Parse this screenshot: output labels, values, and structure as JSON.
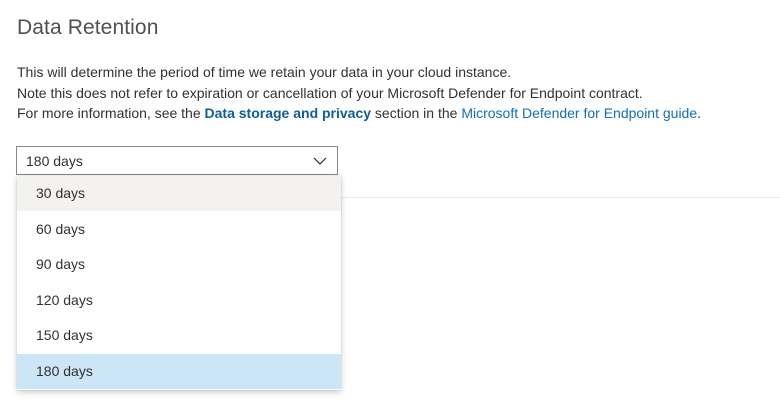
{
  "section": {
    "title": "Data Retention",
    "description_line1": "This will determine the period of time we retain your data in your cloud instance.",
    "description_line2": "Note this does not refer to expiration or cancellation of your Microsoft Defender for Endpoint contract.",
    "description_line3_prefix": "For more information, see the ",
    "description_line3_link1": "Data storage and privacy",
    "description_line3_middle": " section in the ",
    "description_line3_link2": "Microsoft Defender for Endpoint guide",
    "description_line3_suffix": "."
  },
  "retention_select": {
    "selected_value": "180 days",
    "icon": "chevron-down-icon",
    "options": [
      {
        "label": "30 days",
        "state": "hover"
      },
      {
        "label": "60 days",
        "state": "normal"
      },
      {
        "label": "90 days",
        "state": "normal"
      },
      {
        "label": "120 days",
        "state": "normal"
      },
      {
        "label": "150 days",
        "state": "normal"
      },
      {
        "label": "180 days",
        "state": "selected"
      }
    ]
  },
  "colors": {
    "link": "#106ebe",
    "link_bold": "#0f5c9a",
    "hover_bg": "#f3f2f1",
    "selected_bg": "#cde6f7"
  }
}
